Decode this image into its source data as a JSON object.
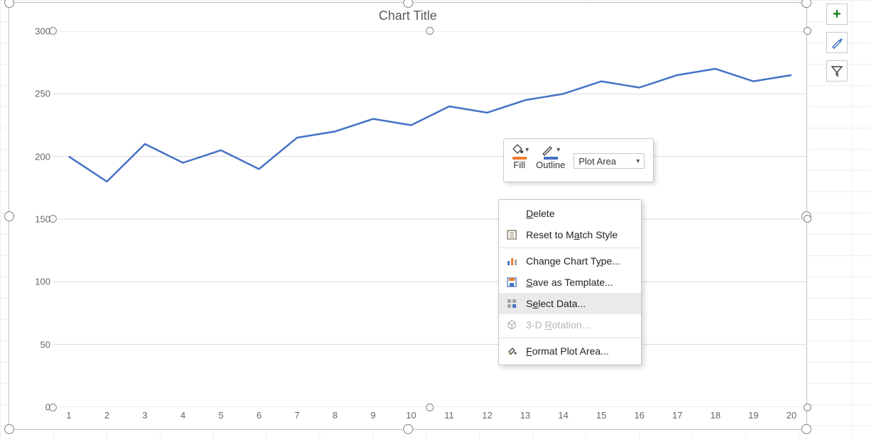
{
  "chart_data": {
    "type": "line",
    "title": "Chart Title",
    "xlabel": "",
    "ylabel": "",
    "categories": [
      "1",
      "2",
      "3",
      "4",
      "5",
      "6",
      "7",
      "8",
      "9",
      "10",
      "11",
      "12",
      "13",
      "14",
      "15",
      "16",
      "17",
      "18",
      "19",
      "20"
    ],
    "values": [
      200,
      180,
      210,
      195,
      205,
      190,
      215,
      220,
      230,
      225,
      240,
      235,
      245,
      250,
      260,
      255,
      265,
      270,
      260,
      265
    ],
    "ylim": [
      0,
      300
    ],
    "yticks": [
      0,
      50,
      100,
      150,
      200,
      250,
      300
    ],
    "series_color": "#4472C4"
  },
  "mini_toolbar": {
    "fill_label": "Fill",
    "outline_label": "Outline",
    "selected_element": "Plot Area",
    "fill_swatch": "#ED7D31",
    "outline_swatch": "#4472C4"
  },
  "context_menu": {
    "items": [
      {
        "key": "delete",
        "label": "Delete",
        "accel": "D",
        "icon": "",
        "disabled": false
      },
      {
        "key": "reset",
        "label": "Reset to Match Style",
        "accel": "a",
        "icon": "reset",
        "disabled": false
      },
      {
        "key": "sep1",
        "separator": true
      },
      {
        "key": "cctype",
        "label": "Change Chart Type...",
        "accel": "y",
        "icon": "cctype",
        "disabled": false
      },
      {
        "key": "savetpl",
        "label": "Save as Template...",
        "accel": "S",
        "icon": "savetpl",
        "disabled": false
      },
      {
        "key": "seldata",
        "label": "Select Data...",
        "accel": "e",
        "icon": "seldata",
        "disabled": false,
        "hover": true
      },
      {
        "key": "rot3d",
        "label": "3-D Rotation...",
        "accel": "R",
        "icon": "rot3d",
        "disabled": true
      },
      {
        "key": "sep2",
        "separator": true
      },
      {
        "key": "fmtpa",
        "label": "Format Plot Area...",
        "accel": "F",
        "icon": "fmtpa",
        "disabled": false
      }
    ]
  },
  "side_buttons": {
    "add": "chart-elements",
    "brush": "chart-styles",
    "funnel": "chart-filters"
  }
}
